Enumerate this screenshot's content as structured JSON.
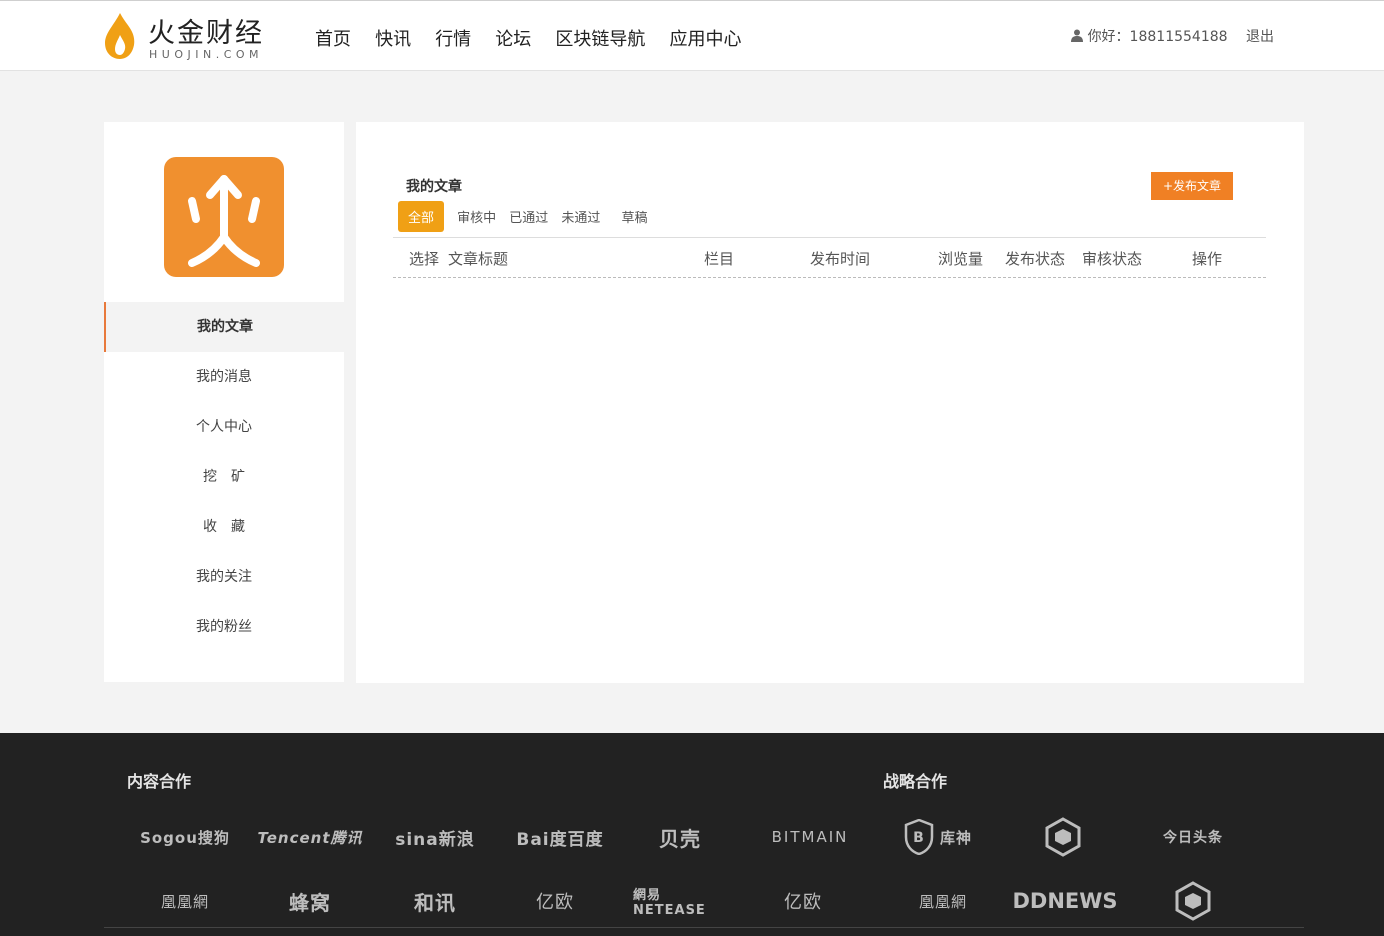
{
  "header": {
    "logo": {
      "word": "火金财经",
      "domain": "HUOJIN.COM"
    },
    "nav": [
      {
        "label": "首页"
      },
      {
        "label": "快讯"
      },
      {
        "label": "行情"
      },
      {
        "label": "论坛"
      },
      {
        "label": "区块链导航"
      },
      {
        "label": "应用中心"
      }
    ],
    "user": {
      "greeting": "你好：18811554188",
      "logout": "退出"
    }
  },
  "sidebar": {
    "menu": [
      {
        "label": "我的文章"
      },
      {
        "label": "我的消息"
      },
      {
        "label": "个人中心"
      },
      {
        "label": "挖　矿"
      },
      {
        "label": "收　藏"
      },
      {
        "label": "我的关注"
      },
      {
        "label": "我的粉丝"
      }
    ]
  },
  "main": {
    "title": "我的文章",
    "publish_label": "+发布文章",
    "tabs": [
      "全部",
      "审核中",
      "已通过",
      "未通过",
      "草稿"
    ],
    "columns": [
      "选择",
      "文章标题",
      "栏目",
      "发布时间",
      "浏览量",
      "发布状态",
      "审核状态",
      "操作"
    ]
  },
  "footer": {
    "content_title": "内容合作",
    "strategy_title": "战略合作",
    "row1": [
      "Sogou搜狗",
      "Tencent腾讯",
      "sina新浪",
      "Bai度百度",
      "贝壳",
      "BITMAIN",
      "库神",
      "",
      "今日头条"
    ],
    "row2": [
      "凰凰網",
      "蜂窝",
      "和讯",
      "亿欧",
      "網易 NETEASE",
      "亿欧",
      "凰凰網",
      "DDNEWS",
      ""
    ],
    "colors": {
      "background": "#222222",
      "logo_text": "#bdbdbd"
    }
  },
  "colors": {
    "accent": "#f08024",
    "tab_active": "#f0a015",
    "logo_flame": "#f0a015"
  }
}
